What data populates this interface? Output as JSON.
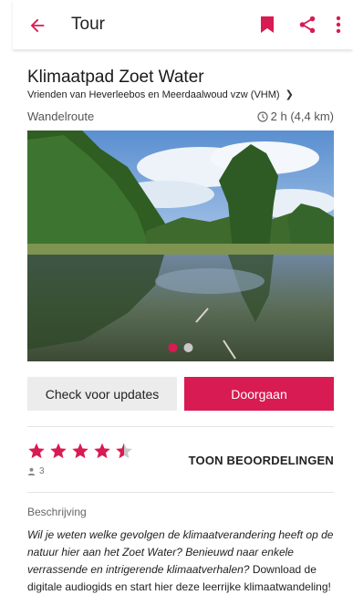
{
  "appbar": {
    "title": "Tour",
    "accent": "#d81b52",
    "icons": [
      "back-arrow-icon",
      "bookmark-icon",
      "share-icon",
      "more-vert-icon"
    ]
  },
  "tour": {
    "name": "Klimaatpad Zoet Water",
    "organizer": "Vrienden van Heverleebos en Meerdaalwoud vzw (VHM)",
    "type": "Wandelroute",
    "duration": "2 h (4,4 km)"
  },
  "gallery": {
    "slide_count": 2,
    "active_slide": 1
  },
  "buttons": {
    "check_updates": "Check voor updates",
    "continue": "Doorgaan"
  },
  "reviews": {
    "rating": 4.5,
    "max_rating": 5,
    "count": "3",
    "show_label": "TOON BEOORDELINGEN"
  },
  "description": {
    "label": "Beschrijving",
    "italic_text": "Wil je weten welke gevolgen de klimaatverandering heeft op de natuur hier aan het Zoet Water? Benieuwd naar enkele verrassende en intrigerende klimaatverhalen?",
    "plain_text": "Download de digitale audiogids en start hier deze leerrijke klimaatwandeling!"
  }
}
